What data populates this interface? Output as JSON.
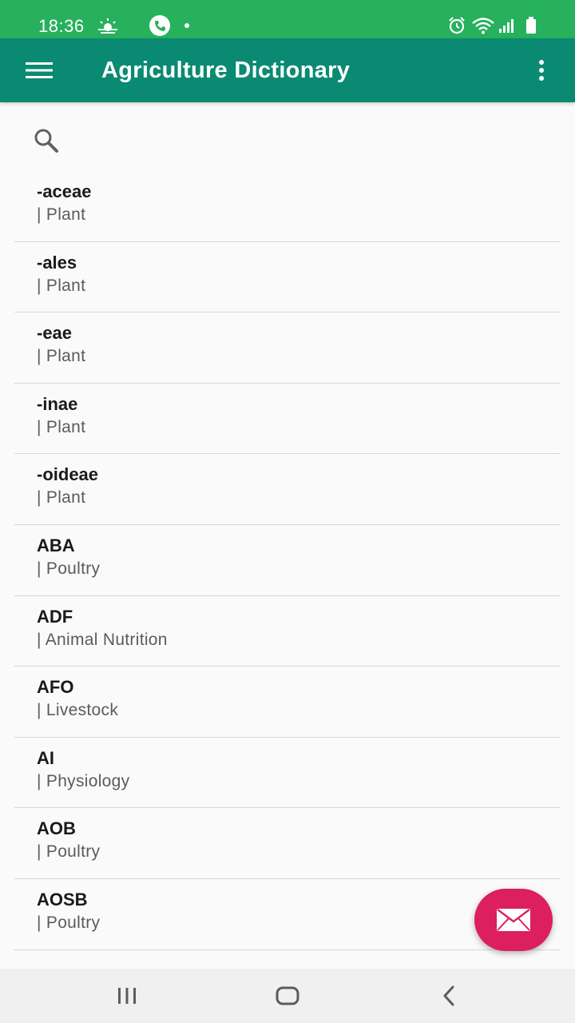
{
  "status_bar": {
    "time": "18:36",
    "background": "#27b15d",
    "left_icons": [
      "weather-icon",
      "phone-call-icon",
      "notification-dot-icon"
    ],
    "right_icons": [
      "alarm-icon",
      "wifi-icon",
      "signal-icon",
      "battery-icon"
    ]
  },
  "app_bar": {
    "title": "Agriculture Dictionary",
    "background": "#0a8a72",
    "menu_icon": "hamburger-menu-icon",
    "overflow_icon": "more-vertical-icon"
  },
  "search": {
    "icon": "search-icon",
    "value": "",
    "placeholder": ""
  },
  "terms": [
    {
      "name": "-aceae",
      "category": " | Plant"
    },
    {
      "name": "-ales",
      "category": " | Plant"
    },
    {
      "name": "-eae",
      "category": " | Plant"
    },
    {
      "name": "-inae",
      "category": " | Plant"
    },
    {
      "name": "-oideae",
      "category": " | Plant"
    },
    {
      "name": "ABA",
      "category": " | Poultry"
    },
    {
      "name": "ADF",
      "category": " | Animal Nutrition"
    },
    {
      "name": "AFO",
      "category": " | Livestock"
    },
    {
      "name": "AI",
      "category": " | Physiology"
    },
    {
      "name": "AOB",
      "category": " | Poultry"
    },
    {
      "name": "AOSB",
      "category": " | Poultry"
    }
  ],
  "fab": {
    "icon": "mail-icon",
    "color": "#dc1f5f"
  },
  "nav_bar": {
    "buttons": [
      "recent-apps-icon",
      "home-icon",
      "back-icon"
    ]
  }
}
